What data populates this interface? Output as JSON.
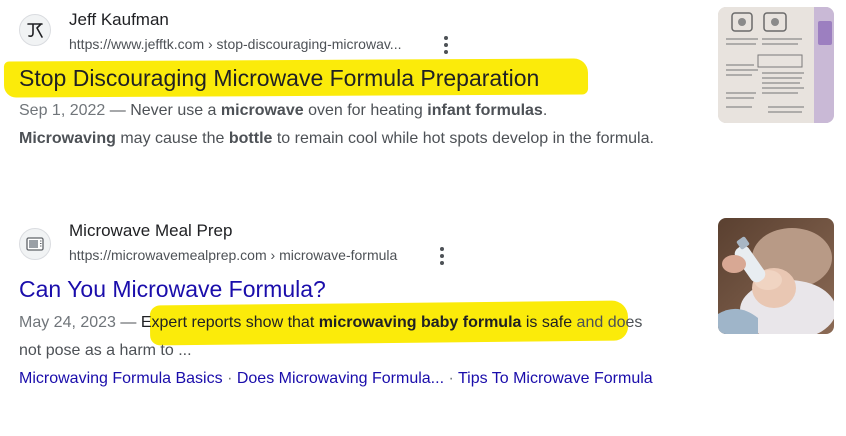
{
  "results": [
    {
      "site_name": "Jeff Kaufman",
      "url": "https://www.jefftk.com › stop-discouraging-microwav...",
      "title": "Stop Discouraging Microwave Formula Preparation",
      "snippet": {
        "date": "Sep 1, 2022",
        "dash": " — ",
        "parts": [
          "Never use a ",
          "microwave",
          " oven for heating ",
          "infant formulas",
          ". ",
          "Microwaving",
          " may cause the ",
          "bottle",
          " to remain cool while hot spots develop in the formula."
        ]
      },
      "favicon_icon": "jk-monogram-icon",
      "thumbnail": "formula-can-instructions-image"
    },
    {
      "site_name": "Microwave Meal Prep",
      "url": "https://microwavemealprep.com › microwave-formula",
      "title": "Can You Microwave Formula?",
      "snippet": {
        "date": "May 24, 2023",
        "dash": " — ",
        "parts": [
          "Expert reports show that ",
          "microwaving baby formula",
          " is safe",
          " and does not pose as a harm to ..."
        ]
      },
      "sitelinks": [
        "Microwaving Formula Basics",
        "Does Microwaving Formula...",
        "Tips To Microwave Formula"
      ],
      "sitelink_separator": "·",
      "favicon_icon": "microwave-icon",
      "thumbnail": "baby-bottle-feeding-image"
    }
  ],
  "colors": {
    "highlight": "#fbeb0a",
    "link": "#1a0dab",
    "snippet_text": "#4d5156"
  }
}
